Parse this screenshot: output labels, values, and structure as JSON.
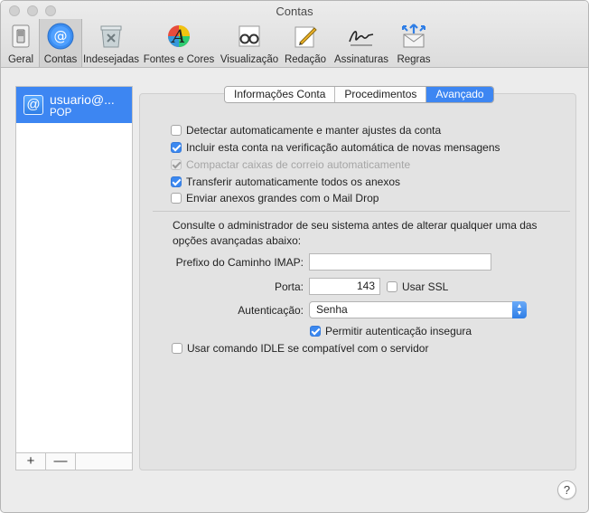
{
  "window": {
    "title": "Contas"
  },
  "toolbar": {
    "items": [
      {
        "label": "Geral",
        "icon": "general-switch-icon"
      },
      {
        "label": "Contas",
        "icon": "at-sign-icon",
        "selected": true
      },
      {
        "label": "Indesejadas",
        "icon": "junk-trash-icon"
      },
      {
        "label": "Fontes e Cores",
        "icon": "fonts-colors-icon"
      },
      {
        "label": "Visualização",
        "icon": "glasses-icon"
      },
      {
        "label": "Redação",
        "icon": "compose-pencil-icon"
      },
      {
        "label": "Assinaturas",
        "icon": "signature-icon"
      },
      {
        "label": "Regras",
        "icon": "rules-envelope-icon"
      }
    ]
  },
  "sidebar": {
    "account": {
      "name": "usuario@...",
      "type": "POP",
      "icon": "at-sign-icon"
    },
    "add_label": "+",
    "remove_label": "—"
  },
  "tabs": [
    {
      "label": "Informações Conta",
      "active": false
    },
    {
      "label": "Procedimentos",
      "active": false
    },
    {
      "label": "Avançado",
      "active": true
    }
  ],
  "options": {
    "auto_detect": {
      "label": "Detectar automaticamente e manter ajustes da conta",
      "checked": false
    },
    "include_check": {
      "label": "Incluir esta conta na verificação automática de novas mensagens",
      "checked": true
    },
    "compact": {
      "label": "Compactar caixas de correio automaticamente",
      "checked": true,
      "disabled": true
    },
    "download_attachments": {
      "label": "Transferir automaticamente todos os anexos",
      "checked": true
    },
    "mail_drop": {
      "label": "Enviar anexos grandes com o Mail Drop",
      "checked": false
    }
  },
  "advanced_note": "Consulte o administrador de seu sistema antes de alterar qualquer uma das opções avançadas abaixo:",
  "imap_prefix": {
    "label": "Prefixo do Caminho IMAP:",
    "value": ""
  },
  "port": {
    "label": "Porta:",
    "value": "143"
  },
  "use_ssl": {
    "label": "Usar SSL",
    "checked": false
  },
  "authentication": {
    "label": "Autenticação:",
    "value": "Senha"
  },
  "allow_insecure": {
    "label": "Permitir autenticação insegura",
    "checked": true
  },
  "idle": {
    "label": "Usar comando IDLE se compatível com o servidor",
    "checked": false
  },
  "help": {
    "label": "?"
  },
  "colors": {
    "accent": "#3d86f2",
    "panel": "#e3e3e3",
    "window": "#ececec"
  }
}
